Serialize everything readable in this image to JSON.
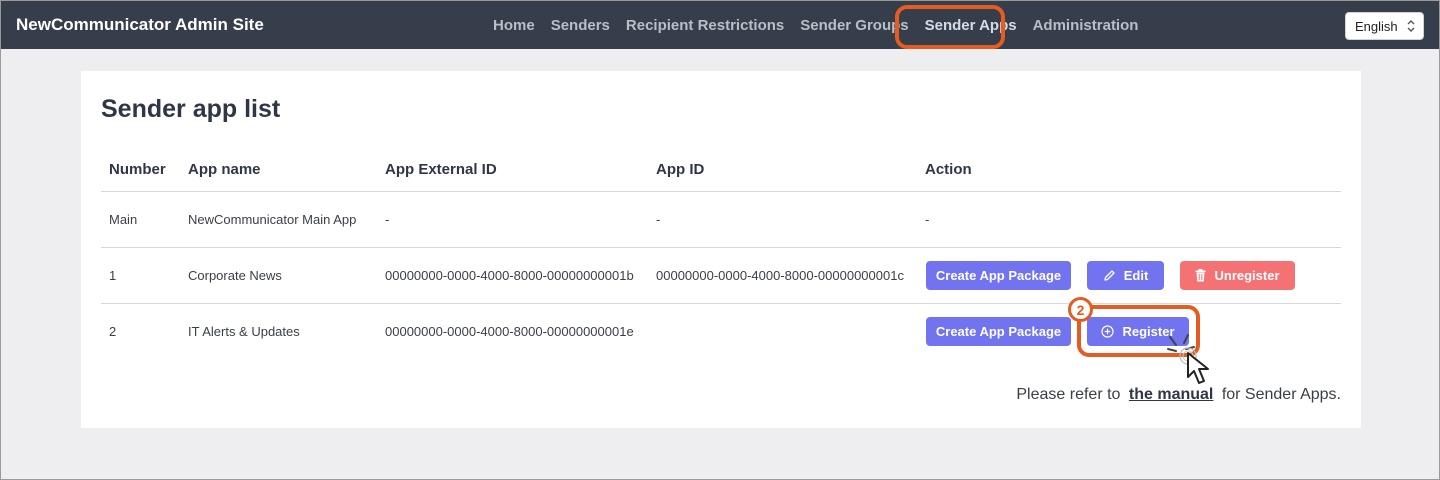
{
  "app": {
    "title": "NewCommunicator Admin Site"
  },
  "nav": {
    "items": [
      {
        "label": "Home"
      },
      {
        "label": "Senders"
      },
      {
        "label": "Recipient Restrictions"
      },
      {
        "label": "Sender Groups"
      },
      {
        "label": "Sender Apps",
        "active": true
      },
      {
        "label": "Administration"
      }
    ]
  },
  "language": {
    "selected": "English"
  },
  "page": {
    "title": "Sender app list"
  },
  "table": {
    "headers": [
      "Number",
      "App name",
      "App External ID",
      "App ID",
      "Action"
    ],
    "rows": [
      {
        "number": "Main",
        "app_name": "NewCommunicator Main App",
        "external_id": "-",
        "app_id": "-",
        "action": "-"
      },
      {
        "number": "1",
        "app_name": "Corporate News",
        "external_id": "00000000-0000-4000-8000-00000000001b",
        "app_id": "00000000-0000-4000-8000-00000000001c",
        "buttons": {
          "create_package": "Create App Package",
          "edit": "Edit",
          "unregister": "Unregister"
        }
      },
      {
        "number": "2",
        "app_name": "IT Alerts & Updates",
        "external_id": "00000000-0000-4000-8000-00000000001e",
        "app_id": "",
        "buttons": {
          "create_package": "Create App Package",
          "register": "Register"
        }
      }
    ]
  },
  "annotation": {
    "step": "2"
  },
  "footer": {
    "prefix": "Please refer to",
    "link": "the manual",
    "suffix": "for Sender Apps."
  },
  "colors": {
    "navbar": "#363d4b",
    "primary": "#7173ef",
    "danger": "#f47174",
    "highlight": "#e65b22"
  }
}
